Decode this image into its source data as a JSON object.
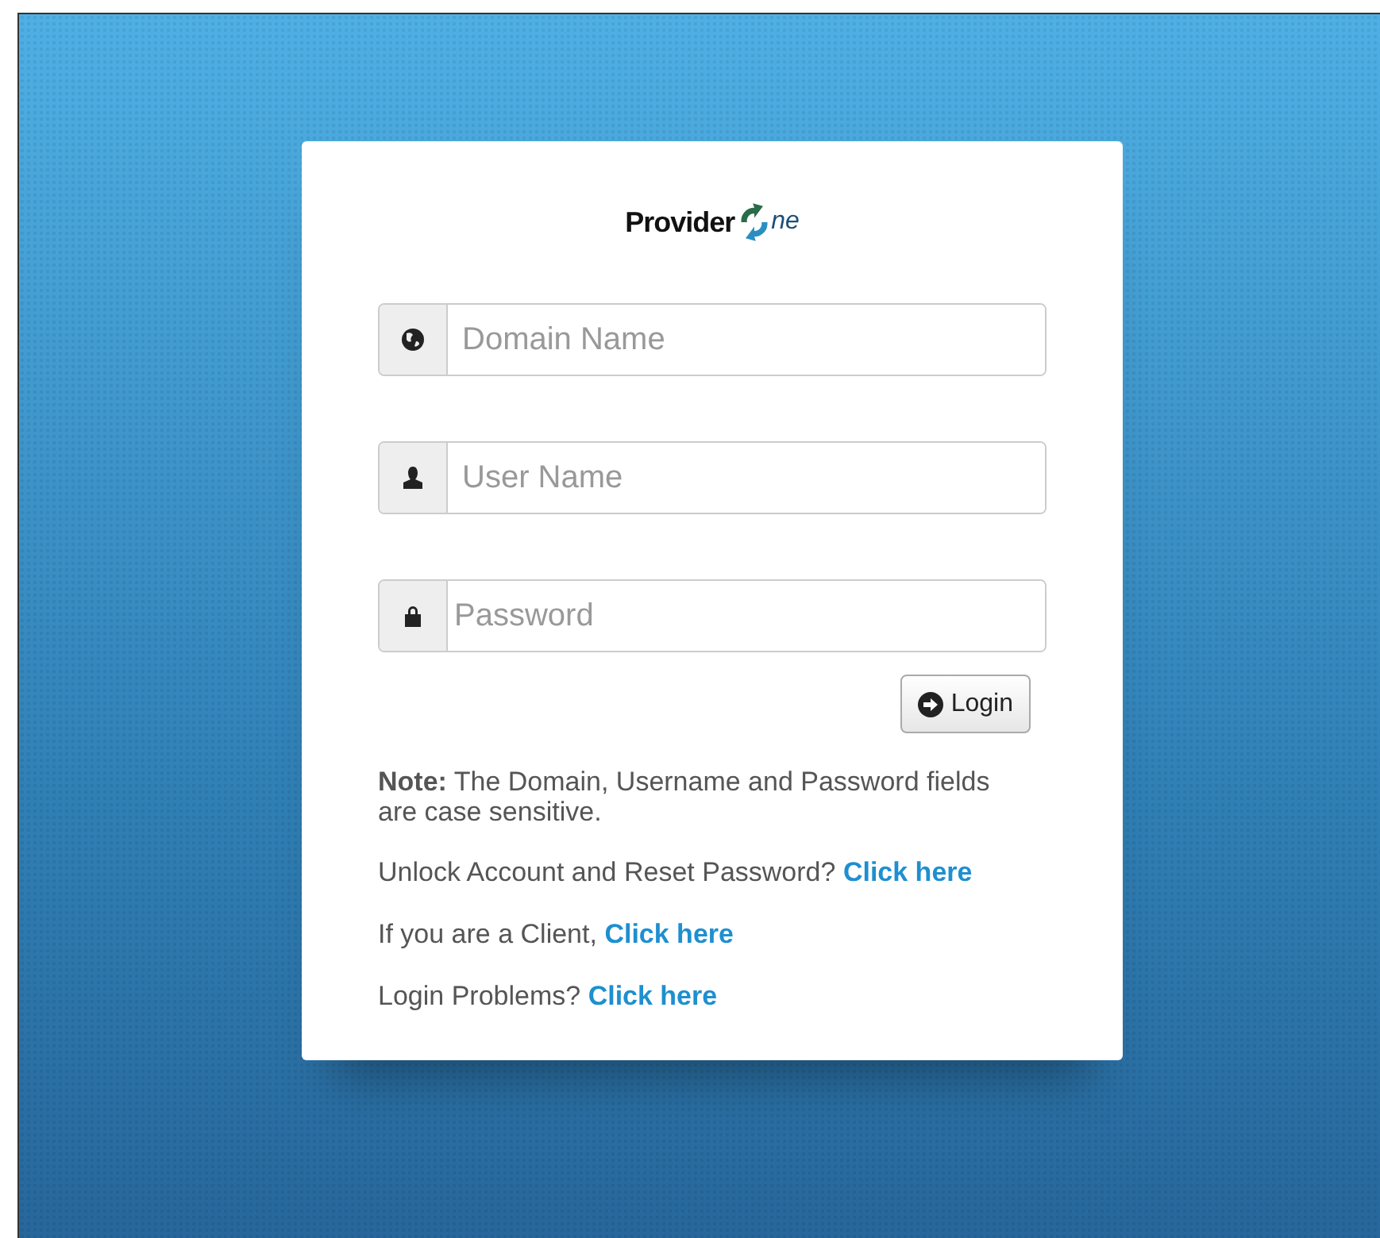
{
  "logo": {
    "word": "Provider",
    "suffix": "ne"
  },
  "fields": [
    {
      "kind": "globe",
      "placeholder": "Domain Name"
    },
    {
      "kind": "user",
      "placeholder": "User Name"
    },
    {
      "kind": "lock",
      "placeholder": "Password"
    }
  ],
  "login_button": "Login",
  "note": "**Note:** The Domain, Username and Password fields are case sensitive.",
  "help": [
    {
      "text": "Unlock Account and Reset Password?",
      "link": "Click here"
    },
    {
      "text": "If you are a Client,",
      "link": "Click here"
    },
    {
      "text": "Login Problems?",
      "link": "Click here"
    }
  ]
}
